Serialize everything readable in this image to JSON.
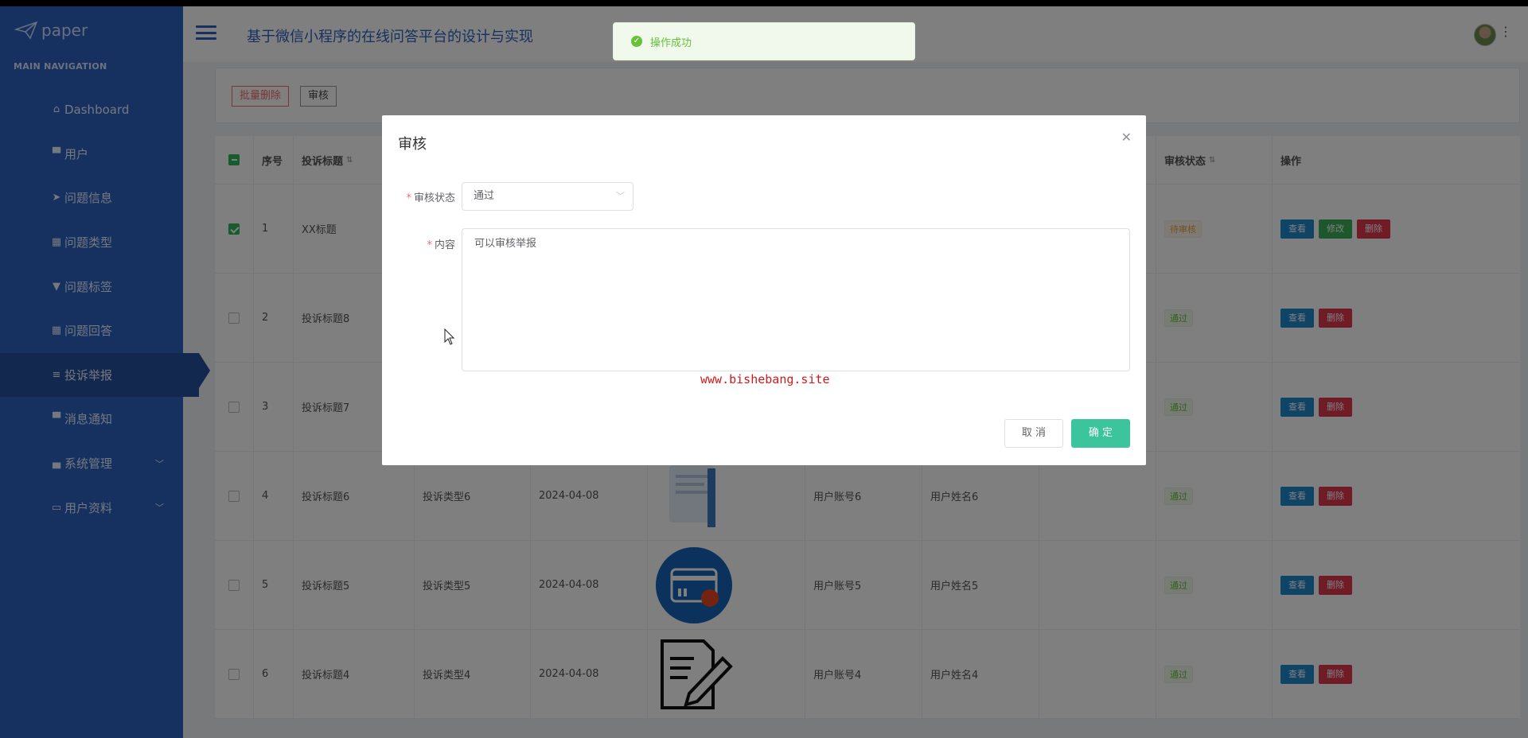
{
  "logo": {
    "text": "paper",
    "icon": "paper-plane-icon"
  },
  "sidebar": {
    "nav_title": "MAIN NAVIGATION",
    "items": [
      {
        "icon": "home-icon",
        "glyph": "⌂",
        "label": "Dashboard"
      },
      {
        "icon": "comment-icon",
        "glyph": "▀",
        "label": "用户"
      },
      {
        "icon": "send-icon",
        "glyph": "➤",
        "label": "问题信息"
      },
      {
        "icon": "grid-icon",
        "glyph": "▦",
        "label": "问题类型"
      },
      {
        "icon": "tag-icon",
        "glyph": "▼",
        "label": "问题标签"
      },
      {
        "icon": "grid-icon",
        "glyph": "▦",
        "label": "问题回答"
      },
      {
        "icon": "list-icon",
        "glyph": "≡",
        "label": "投诉举报"
      },
      {
        "icon": "comment-icon",
        "glyph": "▀",
        "label": "消息通知"
      },
      {
        "icon": "lock-icon",
        "glyph": "▄",
        "label": "系统管理"
      },
      {
        "icon": "calendar-icon",
        "glyph": "▭",
        "label": "用户资料"
      }
    ],
    "active_index": 6
  },
  "header": {
    "title": "基于微信小程序的在线问答平台的设计与实现",
    "more": "⋮"
  },
  "toolbar": {
    "batch_delete": "批量删除",
    "audit": "审核"
  },
  "table": {
    "headers": [
      "序号",
      "投诉标题",
      "",
      "",
      "",
      "",
      "",
      "",
      "审核状态",
      "操作"
    ],
    "rows": [
      {
        "no": "1",
        "title": "XX标题",
        "type": "",
        "date": "",
        "image": "none",
        "account": "",
        "name": "",
        "extra": "",
        "status": "待审核",
        "checked": true,
        "ops": [
          "查看",
          "修改",
          "删除"
        ]
      },
      {
        "no": "2",
        "title": "投诉标题8",
        "type": "",
        "date": "",
        "image": "none",
        "account": "",
        "name": "",
        "extra": "",
        "status": "通过",
        "checked": false,
        "ops": [
          "查看",
          "删除"
        ]
      },
      {
        "no": "3",
        "title": "投诉标题7",
        "type": "",
        "date": "",
        "image": "none",
        "account": "",
        "name": "",
        "extra": "",
        "status": "通过",
        "checked": false,
        "ops": [
          "查看",
          "删除"
        ]
      },
      {
        "no": "4",
        "title": "投诉标题6",
        "type": "投诉类型6",
        "date": "2024-04-08",
        "image": "document",
        "account": "用户账号6",
        "name": "用户姓名6",
        "extra": "",
        "status": "通过",
        "checked": false,
        "ops": [
          "查看",
          "删除"
        ]
      },
      {
        "no": "5",
        "title": "投诉标题5",
        "type": "投诉类型5",
        "date": "2024-04-08",
        "image": "card",
        "account": "用户账号5",
        "name": "用户姓名5",
        "extra": "",
        "status": "通过",
        "checked": false,
        "ops": [
          "查看",
          "删除"
        ]
      },
      {
        "no": "6",
        "title": "投诉标题4",
        "type": "投诉类型4",
        "date": "2024-04-08",
        "image": "sign",
        "account": "用户账号4",
        "name": "用户姓名4",
        "extra": "",
        "status": "通过",
        "checked": false,
        "ops": [
          "查看",
          "删除"
        ]
      }
    ]
  },
  "toast": {
    "text": "操作成功"
  },
  "dialog": {
    "title": "审核",
    "status_label": "审核状态",
    "status_value": "通过",
    "content_label": "内容",
    "content_value": "可以审核举报",
    "watermark": "www.bishebang.site",
    "cancel": "取 消",
    "confirm": "确 定"
  },
  "colors": {
    "sidebar": "#2c62c0",
    "accent": "#2c62c0",
    "confirm": "#3cc49d",
    "danger": "#e0394f",
    "success": "#67c23a"
  }
}
